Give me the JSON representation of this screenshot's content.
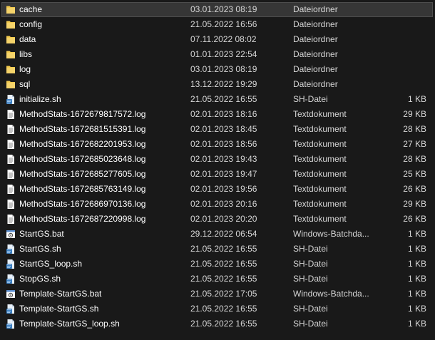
{
  "files": [
    {
      "name": "cache",
      "date": "03.01.2023 08:19",
      "type": "Dateiordner",
      "size": "",
      "icon": "folder-icon",
      "selected": true
    },
    {
      "name": "config",
      "date": "21.05.2022 16:56",
      "type": "Dateiordner",
      "size": "",
      "icon": "folder-icon"
    },
    {
      "name": "data",
      "date": "07.11.2022 08:02",
      "type": "Dateiordner",
      "size": "",
      "icon": "folder-icon"
    },
    {
      "name": "libs",
      "date": "01.01.2023 22:54",
      "type": "Dateiordner",
      "size": "",
      "icon": "folder-icon"
    },
    {
      "name": "log",
      "date": "03.01.2023 08:19",
      "type": "Dateiordner",
      "size": "",
      "icon": "folder-icon"
    },
    {
      "name": "sql",
      "date": "13.12.2022 19:29",
      "type": "Dateiordner",
      "size": "",
      "icon": "folder-icon"
    },
    {
      "name": "initialize.sh",
      "date": "21.05.2022 16:55",
      "type": "SH-Datei",
      "size": "1 KB",
      "icon": "sh-file-icon"
    },
    {
      "name": "MethodStats-1672679817572.log",
      "date": "02.01.2023 18:16",
      "type": "Textdokument",
      "size": "29 KB",
      "icon": "text-file-icon"
    },
    {
      "name": "MethodStats-1672681515391.log",
      "date": "02.01.2023 18:45",
      "type": "Textdokument",
      "size": "28 KB",
      "icon": "text-file-icon"
    },
    {
      "name": "MethodStats-1672682201953.log",
      "date": "02.01.2023 18:56",
      "type": "Textdokument",
      "size": "27 KB",
      "icon": "text-file-icon"
    },
    {
      "name": "MethodStats-1672685023648.log",
      "date": "02.01.2023 19:43",
      "type": "Textdokument",
      "size": "28 KB",
      "icon": "text-file-icon"
    },
    {
      "name": "MethodStats-1672685277605.log",
      "date": "02.01.2023 19:47",
      "type": "Textdokument",
      "size": "25 KB",
      "icon": "text-file-icon"
    },
    {
      "name": "MethodStats-1672685763149.log",
      "date": "02.01.2023 19:56",
      "type": "Textdokument",
      "size": "26 KB",
      "icon": "text-file-icon"
    },
    {
      "name": "MethodStats-1672686970136.log",
      "date": "02.01.2023 20:16",
      "type": "Textdokument",
      "size": "29 KB",
      "icon": "text-file-icon"
    },
    {
      "name": "MethodStats-1672687220998.log",
      "date": "02.01.2023 20:20",
      "type": "Textdokument",
      "size": "26 KB",
      "icon": "text-file-icon"
    },
    {
      "name": "StartGS.bat",
      "date": "29.12.2022 06:54",
      "type": "Windows-Batchda...",
      "size": "1 KB",
      "icon": "batch-file-icon"
    },
    {
      "name": "StartGS.sh",
      "date": "21.05.2022 16:55",
      "type": "SH-Datei",
      "size": "1 KB",
      "icon": "sh-file-icon"
    },
    {
      "name": "StartGS_loop.sh",
      "date": "21.05.2022 16:55",
      "type": "SH-Datei",
      "size": "1 KB",
      "icon": "sh-file-icon"
    },
    {
      "name": "StopGS.sh",
      "date": "21.05.2022 16:55",
      "type": "SH-Datei",
      "size": "1 KB",
      "icon": "sh-file-icon"
    },
    {
      "name": "Template-StartGS.bat",
      "date": "21.05.2022 17:05",
      "type": "Windows-Batchda...",
      "size": "1 KB",
      "icon": "batch-file-icon"
    },
    {
      "name": "Template-StartGS.sh",
      "date": "21.05.2022 16:55",
      "type": "SH-Datei",
      "size": "1 KB",
      "icon": "sh-file-icon"
    },
    {
      "name": "Template-StartGS_loop.sh",
      "date": "21.05.2022 16:55",
      "type": "SH-Datei",
      "size": "1 KB",
      "icon": "sh-file-icon"
    }
  ],
  "colors": {
    "background": "#191919",
    "selected_row": "#363636",
    "folder": "#f2c94c",
    "text": "#ffffff",
    "secondary_text": "#d6d6d6"
  }
}
